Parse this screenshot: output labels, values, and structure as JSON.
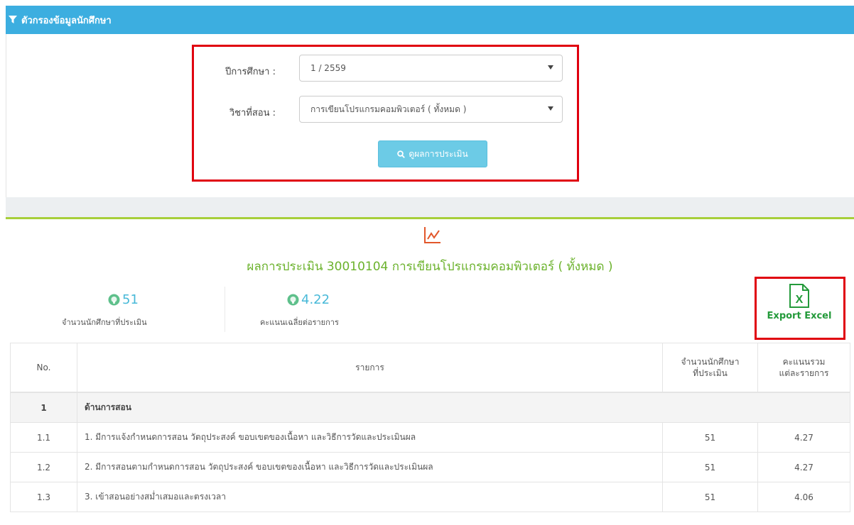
{
  "filter": {
    "header_title": "ตัวกรองข้อมูลนักศึกษา",
    "year_label": "ปีการศึกษา :",
    "year_value": "1 / 2559",
    "subject_label": "วิชาที่สอน :",
    "subject_value": "การเขียนโปรแกรมคอมพิวเตอร์ ( ทั้งหมด )",
    "view_button": "ดูผลการประเมิน"
  },
  "results": {
    "title": "ผลการประเมิน 30010104 การเขียนโปรแกรมคอมพิวเตอร์ ( ทั้งหมด )",
    "stats": [
      {
        "value": "51",
        "label": "จำนวนนักศึกษาที่ประเมิน"
      },
      {
        "value": "4.22",
        "label": "คะแนนเฉลี่ยต่อรายการ"
      }
    ],
    "export_label": "Export Excel"
  },
  "table": {
    "headers": {
      "no": "No.",
      "item": "รายการ",
      "count_line1": "จำนวนนักศึกษา",
      "count_line2": "ที่ประเมิน",
      "score_line1": "คะแนนรวม",
      "score_line2": "แต่ละรายการ"
    },
    "section": {
      "no": "1",
      "title": "ด้านการสอน"
    },
    "rows": [
      {
        "no": "1.1",
        "item": "1. มีการแจ้งกำหนดการสอน วัตถุประสงค์ ขอบเขตของเนื้อหา และวิธีการวัดและประเมินผล",
        "count": "51",
        "score": "4.27"
      },
      {
        "no": "1.2",
        "item": "2. มีการสอนตามกำหนดการสอน วัตถุประสงค์ ขอบเขตของเนื้อหา และวิธีการวัดและประเมินผล",
        "count": "51",
        "score": "4.27"
      },
      {
        "no": "1.3",
        "item": "3. เข้าสอนอย่างสม่ำเสมอและตรงเวลา",
        "count": "51",
        "score": "4.06"
      }
    ]
  },
  "colors": {
    "header_blue": "#3caee0",
    "highlight_red": "#e0000f",
    "title_green": "#6bb22c",
    "excel_green": "#239a3a",
    "stat_blue": "#48b9d8"
  }
}
